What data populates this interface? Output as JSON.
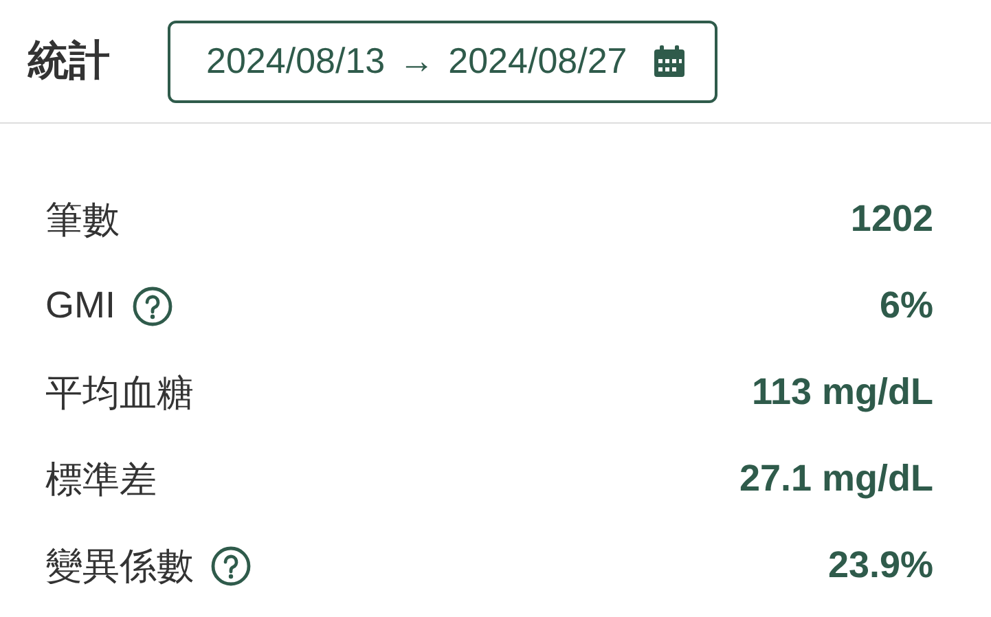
{
  "title": "統計",
  "date_range": {
    "start": "2024/08/13",
    "arrow": "→",
    "end": "2024/08/27"
  },
  "stats": [
    {
      "label": "筆數",
      "help": false,
      "value": "1202"
    },
    {
      "label": "GMI",
      "help": true,
      "value": "6%"
    },
    {
      "label": "平均血糖",
      "help": false,
      "value": "113 mg/dL"
    },
    {
      "label": "標準差",
      "help": false,
      "value": "27.1 mg/dL"
    },
    {
      "label": "變異係數",
      "help": true,
      "value": "23.9%"
    }
  ]
}
